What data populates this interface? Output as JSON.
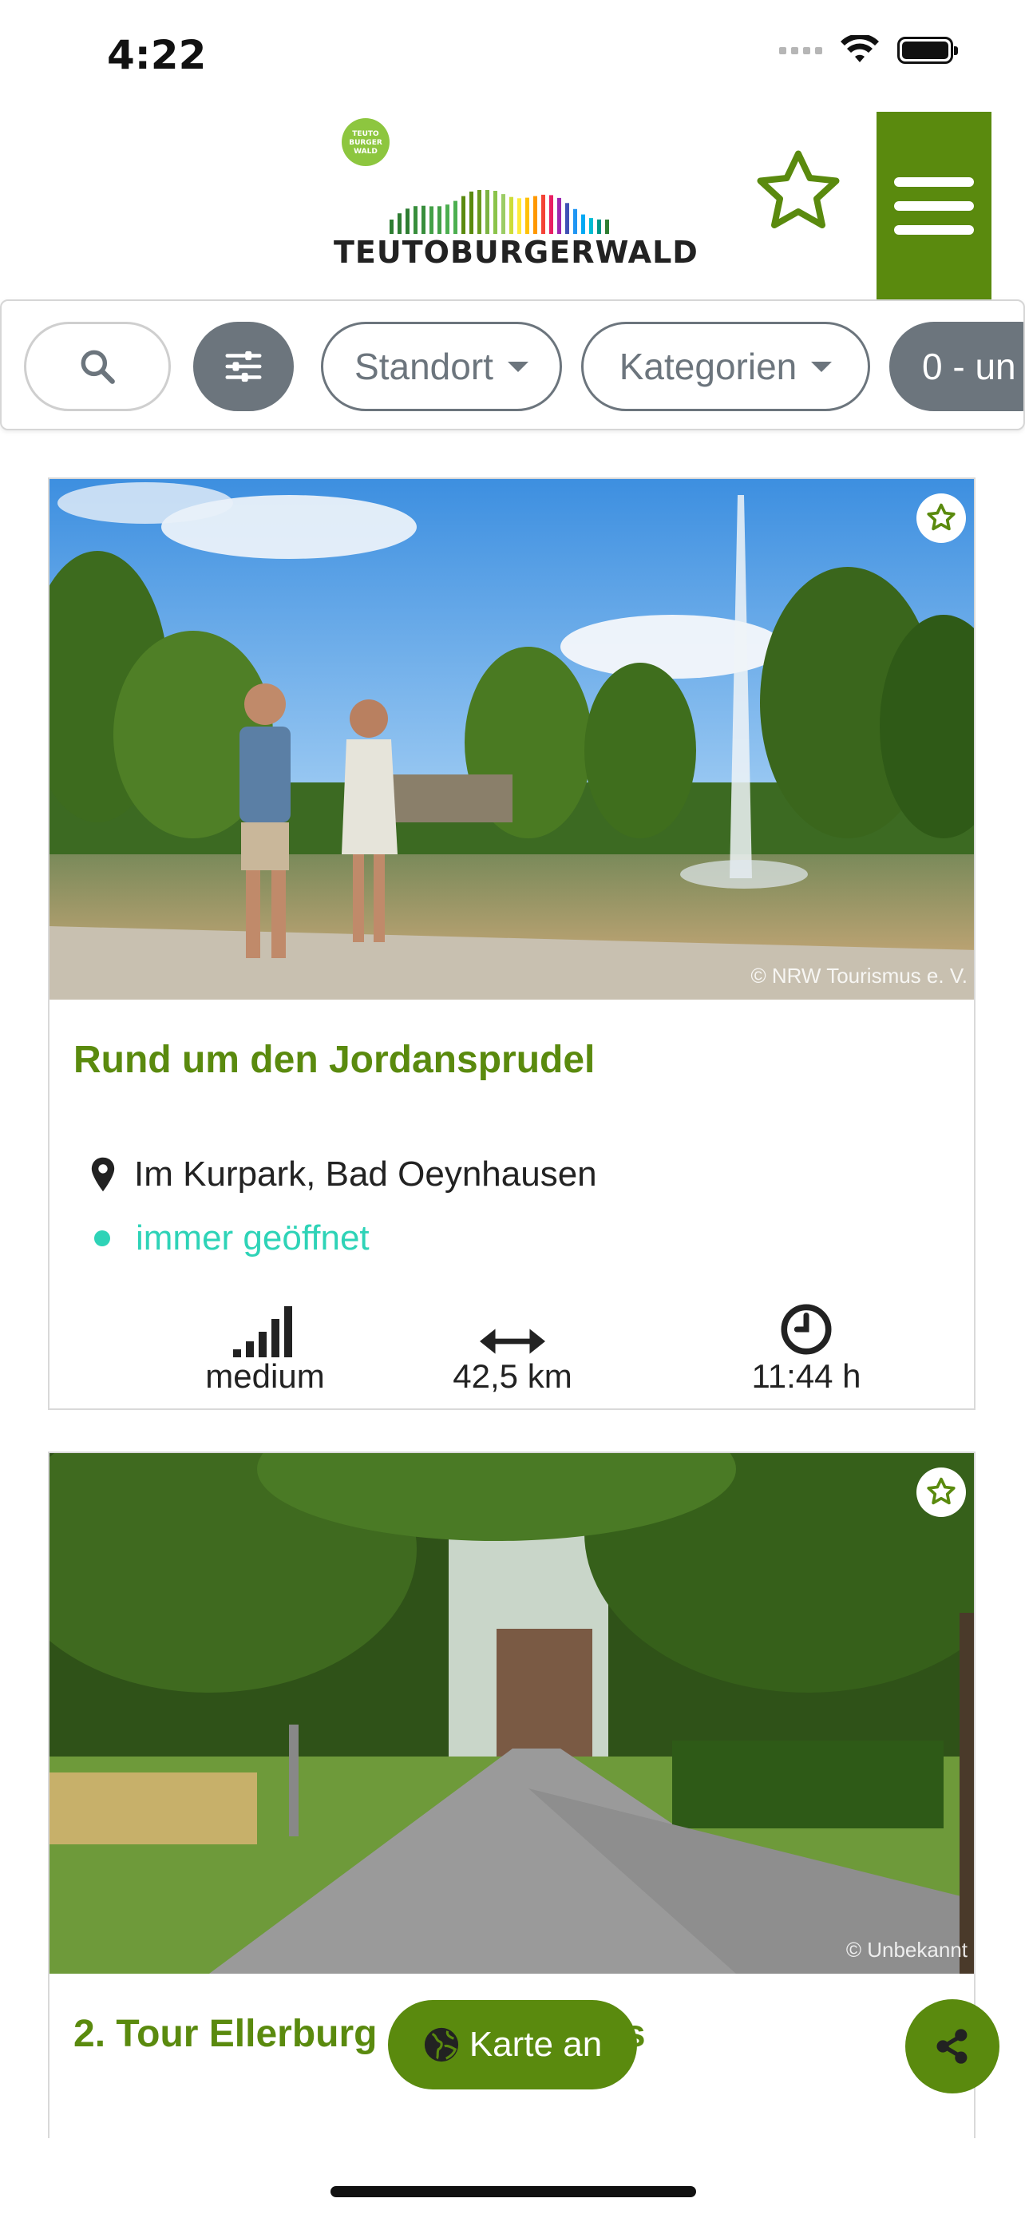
{
  "status_bar": {
    "time": "4:22"
  },
  "header": {
    "logo_text": "TEUTOBURGERWALD",
    "logo_badge": "TEUTO BURGER WALD"
  },
  "filters": {
    "standort": "Standort",
    "kategorien": "Kategorien",
    "range_chip": "0 - un"
  },
  "cards": [
    {
      "title": "Rund um den Jordansprudel",
      "location": "Im Kurpark, Bad Oeynhausen",
      "status": "immer geöffnet",
      "difficulty": "medium",
      "distance": "42,5 km",
      "duration": "11:44 h",
      "credit": "© NRW Tourismus e. V."
    },
    {
      "title": "2. Tour Ellerburg - Ellerburg bis",
      "credit": "© Unbekannt"
    }
  ],
  "fab": {
    "map_label": "Karte an"
  },
  "colors": {
    "brand_green": "#5a8a0e",
    "open_teal": "#2ed3b7",
    "pill_gray": "#6c757d"
  }
}
